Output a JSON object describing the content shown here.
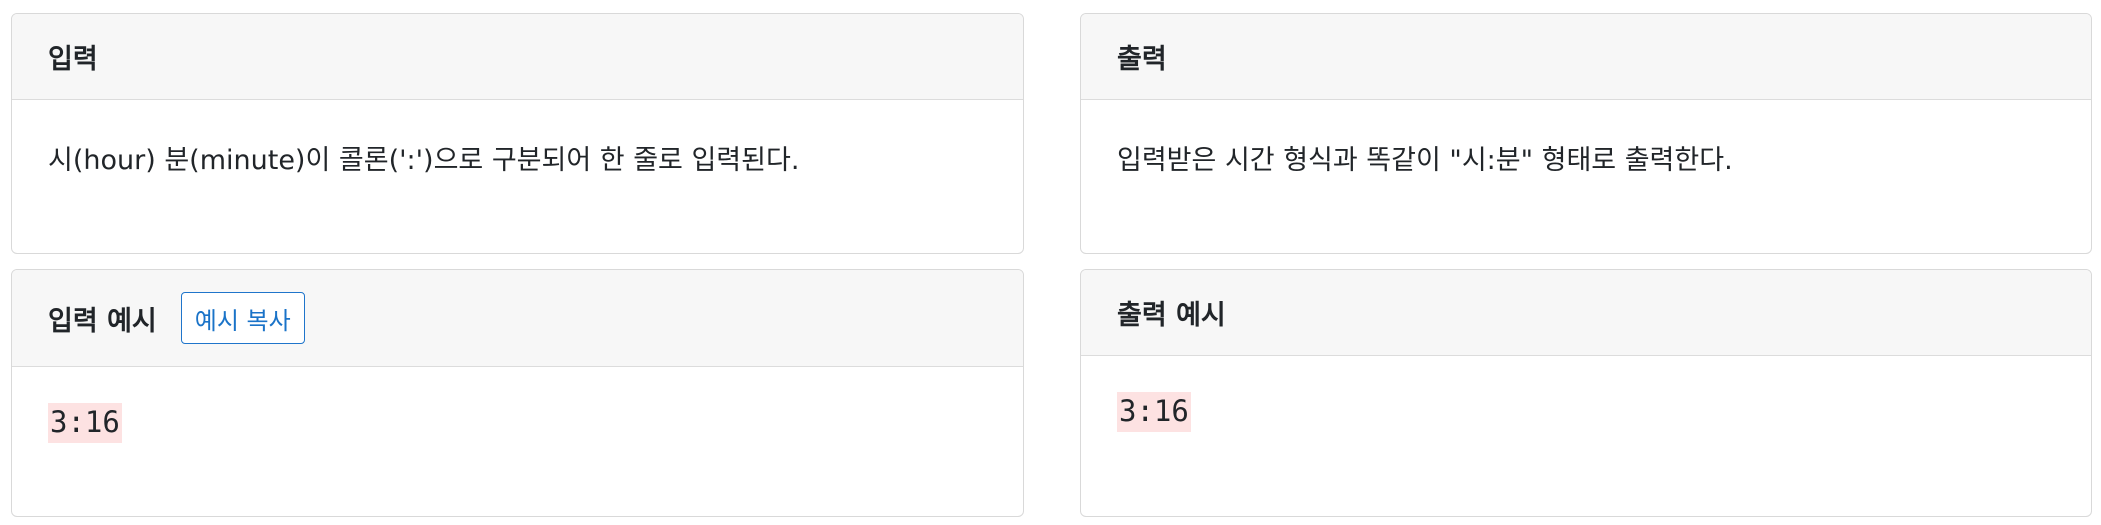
{
  "input_section": {
    "title": "입력",
    "description": "시(hour) 분(minute)이 콜론(':')으로 구분되어 한 줄로 입력된다."
  },
  "output_section": {
    "title": "출력",
    "description": "입력받은 시간 형식과 똑같이 \"시:분\" 형태로 출력한다."
  },
  "sample_input": {
    "title": "입력 예시",
    "copy_button_label": "예시 복사",
    "value": "3:16"
  },
  "sample_output": {
    "title": "출력 예시",
    "value": "3:16"
  }
}
